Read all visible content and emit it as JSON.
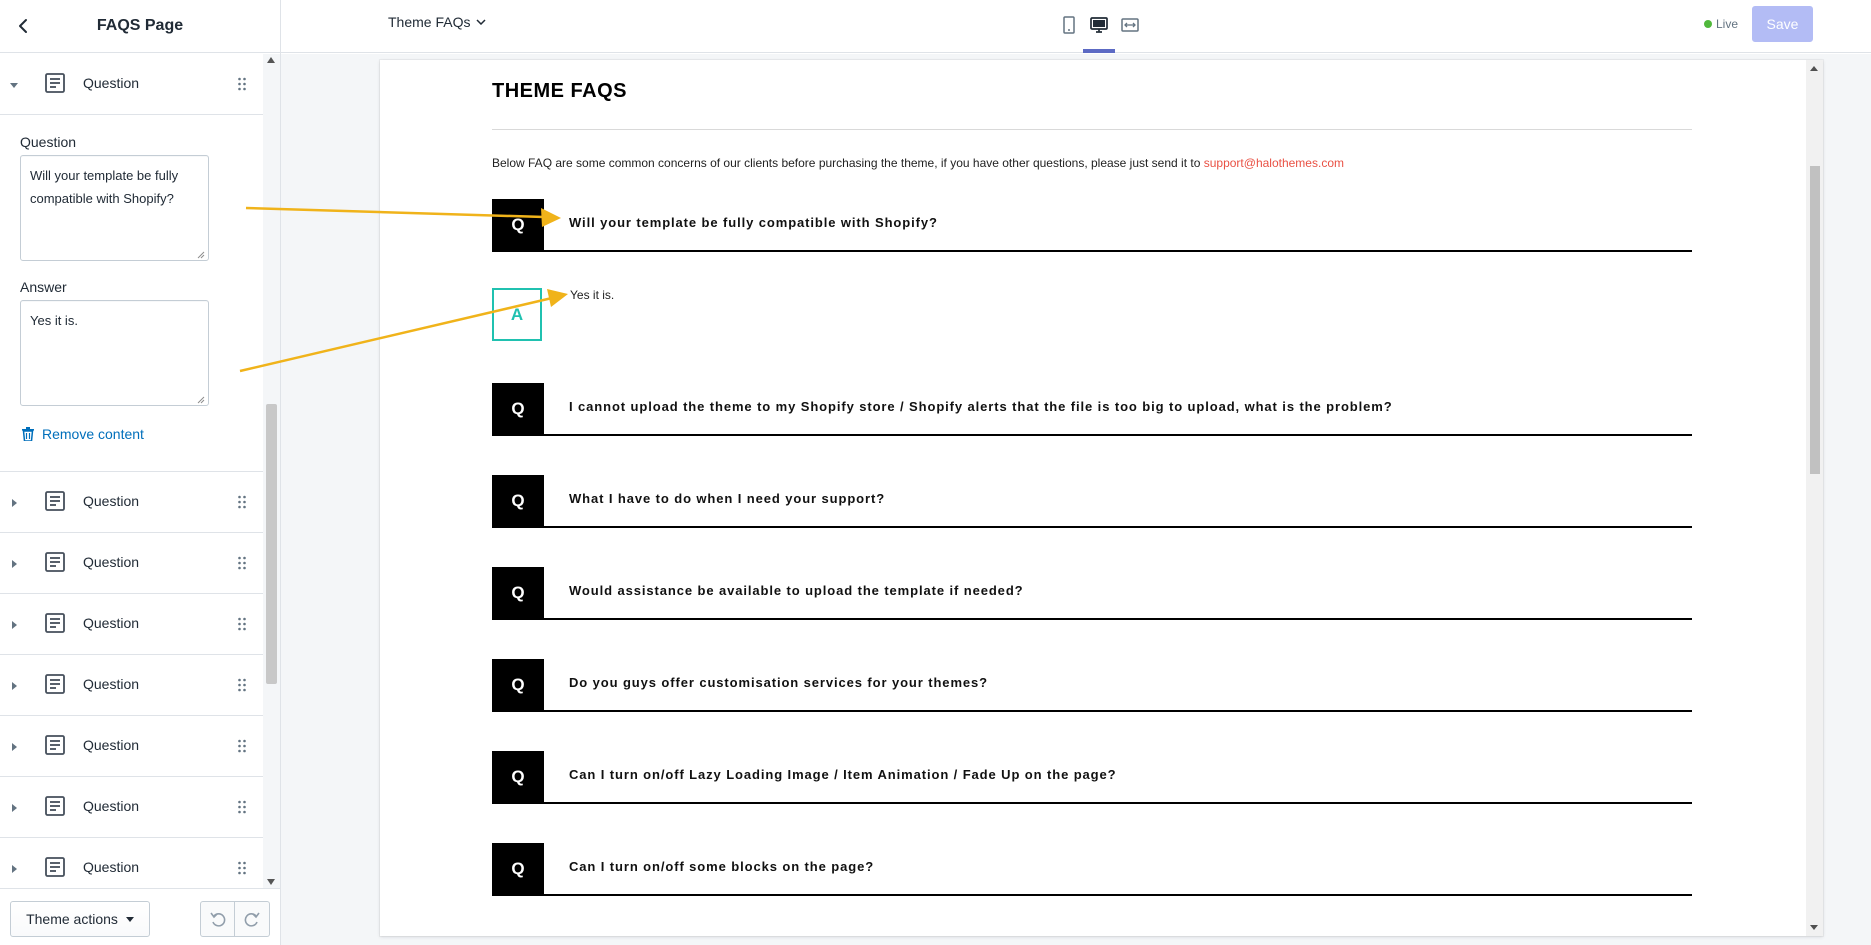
{
  "sidebar": {
    "title": "FAQS Page",
    "expanded_block": {
      "label": "Question",
      "question_label": "Question",
      "question_value": "Will your template be fully compatible with Shopify?",
      "answer_label": "Answer",
      "answer_value": "Yes it is.",
      "remove_label": "Remove content"
    },
    "blocks": [
      {
        "label": "Question"
      },
      {
        "label": "Question"
      },
      {
        "label": "Question"
      },
      {
        "label": "Question"
      },
      {
        "label": "Question"
      },
      {
        "label": "Question"
      },
      {
        "label": "Question"
      }
    ],
    "footer": {
      "theme_actions_label": "Theme actions"
    }
  },
  "topbar": {
    "template_name": "Theme FAQs",
    "live_label": "Live",
    "save_label": "Save",
    "active_view": "desktop"
  },
  "preview": {
    "title": "THEME FAQS",
    "intro": "Below FAQ are some common concerns of our clients before purchasing the theme, if you have other questions, please just send it to",
    "email": "support@halothemes.com",
    "q_badge": "Q",
    "a_badge": "A",
    "answer": "Yes it is.",
    "questions": [
      "Will your template be fully compatible with Shopify?",
      "I cannot upload the theme to my Shopify store / Shopify alerts that the file is too big to upload, what is the problem?",
      "What I have to do when I need your support?",
      "Would assistance be available to upload the template if needed?",
      "Do you guys offer customisation services for your themes?",
      "Can I turn on/off Lazy Loading Image / Item Animation / Fade Up on the page?",
      "Can I turn on/off some blocks on the page?"
    ]
  },
  "colors": {
    "accent": "#5c6ac4",
    "link": "#006fbb",
    "email": "#e95144",
    "answer_badge": "#20c1b0",
    "annotation_arrow": "#f0b31a"
  }
}
